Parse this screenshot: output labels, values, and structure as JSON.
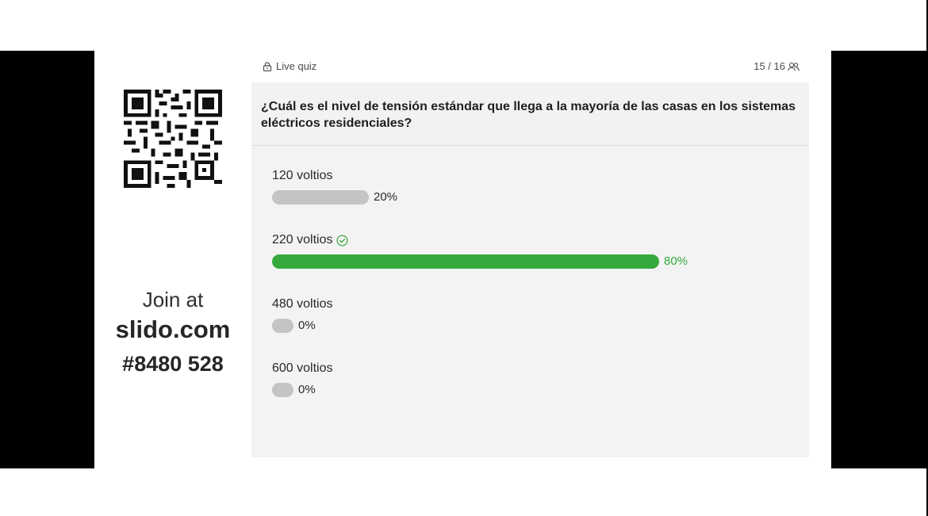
{
  "header": {
    "mode_label": "Live quiz",
    "progress": "15 / 16"
  },
  "join": {
    "prefix": "Join at",
    "url": "slido.com",
    "code": "#8480 528"
  },
  "quiz": {
    "question": "¿Cuál es el nivel de tensión estándar que llega a la mayoría de las casas en los sistemas eléctricos residenciales?",
    "options": [
      {
        "label": "120 voltios",
        "percent": 20,
        "percent_label": "20%",
        "correct": false
      },
      {
        "label": "220 voltios",
        "percent": 80,
        "percent_label": "80%",
        "correct": true
      },
      {
        "label": "480 voltios",
        "percent": 0,
        "percent_label": "0%",
        "correct": false
      },
      {
        "label": "600 voltios",
        "percent": 0,
        "percent_label": "0%",
        "correct": false
      }
    ]
  },
  "icons": {
    "lock": "lock-icon",
    "participants": "participants-icon",
    "correct": "check-circle-icon",
    "qr": "qr-code-icon"
  },
  "colors": {
    "correct": "#36a93d",
    "neutral_bar": "#c4c4c4"
  }
}
